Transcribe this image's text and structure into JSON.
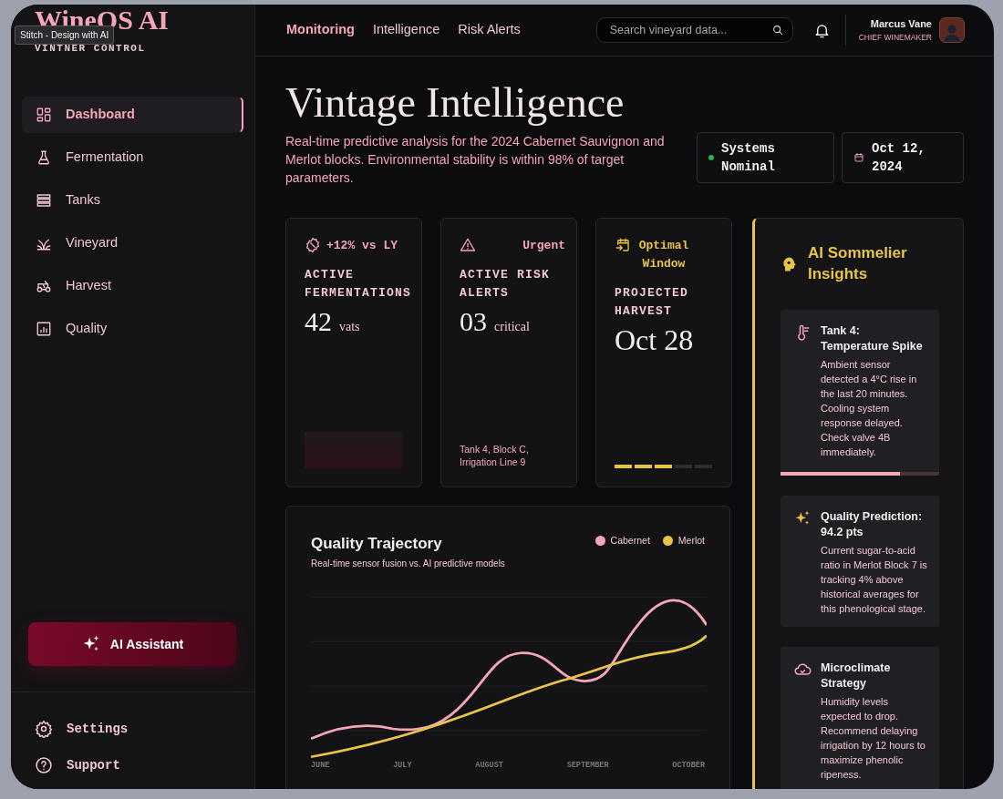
{
  "tooltip": "Stitch - Design with AI",
  "brand": {
    "name": "WineOS AI",
    "subtitle": "VINTNER CONTROL"
  },
  "sidebar": {
    "items": [
      {
        "label": "Dashboard",
        "selected": true
      },
      {
        "label": "Fermentation",
        "selected": false
      },
      {
        "label": "Tanks",
        "selected": false
      },
      {
        "label": "Vineyard",
        "selected": false
      },
      {
        "label": "Harvest",
        "selected": false
      },
      {
        "label": "Quality",
        "selected": false
      }
    ],
    "assistant_button": "AI Assistant",
    "footer_items": [
      {
        "label": "Settings"
      },
      {
        "label": "Support"
      }
    ]
  },
  "topbar": {
    "tabs": [
      {
        "label": "Monitoring",
        "selected": true
      },
      {
        "label": "Intelligence",
        "selected": false
      },
      {
        "label": "Risk Alerts",
        "selected": false
      }
    ],
    "search": {
      "placeholder": "Search vineyard data..."
    },
    "user": {
      "name": "Marcus Vane",
      "role": "CHIEF WINEMAKER"
    }
  },
  "header": {
    "title": "Vintage Intelligence",
    "description": "Real-time predictive analysis for the 2024 Cabernet Sauvignon and Merlot blocks. Environmental stability is within 98% of target parameters.",
    "status": "Systems Nominal",
    "date": "Oct 12, 2024"
  },
  "stats": [
    {
      "kind": "trend",
      "badge": "+12% vs LY",
      "label": "ACTIVE FERMENTATIONS",
      "value": "42",
      "unit": "vats"
    },
    {
      "kind": "alert",
      "badge": "Urgent",
      "label": "ACTIVE RISK ALERTS",
      "value": "03",
      "unit": "critical",
      "note": "Tank 4, Block C, Irrigation Line 9"
    },
    {
      "kind": "window",
      "badge": "Optimal Window",
      "label": "PROJECTED HARVEST",
      "value": "Oct 28",
      "level": 0.6
    }
  ],
  "chart": {
    "title": "Quality Trajectory",
    "subtitle": "Real-time sensor fusion vs. AI predictive models",
    "legend": [
      {
        "name": "Cabernet",
        "color": "#f4a6b8"
      },
      {
        "name": "Merlot",
        "color": "#e8c547"
      }
    ],
    "x_labels": [
      "JUNE",
      "JULY",
      "AUGUST",
      "SEPTEMBER",
      "OCTOBER"
    ]
  },
  "insights": {
    "title": "AI Sommelier Insights",
    "items": [
      {
        "kind": "alert",
        "title": "Tank 4: Temperature Spike",
        "body": "Ambient sensor detected a 4°C rise in the last 20 minutes. Cooling system response delayed. Check valve 4B immediately.",
        "level": 0.75
      },
      {
        "kind": "prediction",
        "title": "Quality Prediction: 94.2 pts",
        "body": "Current sugar-to-acid ratio in Merlot Block 7 is tracking 4% above historical averages for this phenological stage."
      },
      {
        "kind": "climate",
        "title": "Microclimate Strategy",
        "body": "Humidity levels expected to drop. Recommend delaying irrigation by 12 hours to maximize phenolic ripeness."
      }
    ]
  }
}
